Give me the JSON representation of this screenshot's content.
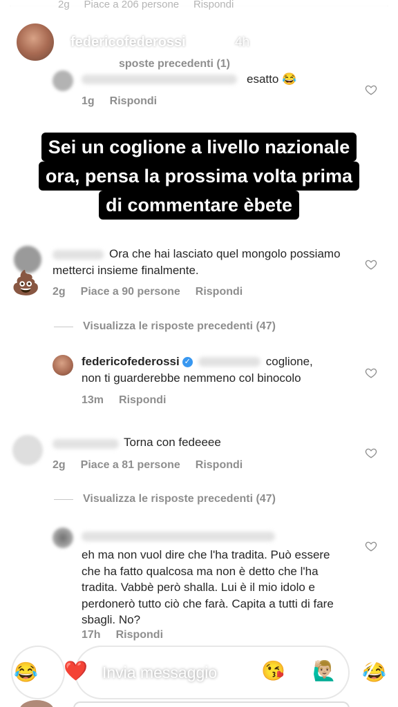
{
  "story": {
    "progress": 1.0,
    "username": "federicofederossi",
    "time": "4h",
    "underlying_text": "sposte precedenti (1)"
  },
  "top_cut_text": "2g     Piace a 206 persone     Rispondi",
  "comments": [
    {
      "text": "esatto 😂",
      "time": "1g",
      "reply": "Rispondi"
    },
    {
      "text": "Ora che hai lasciato quel mongolo possiamo metterci insieme finalmente.",
      "emoji": "💩",
      "time": "2g",
      "likes": "Piace a 90 persone",
      "reply": "Rispondi"
    },
    {
      "view_replies": "Visualizza le risposte precedenti (47)"
    },
    {
      "username": "federicofederossi",
      "text_line1": "coglione,",
      "text_line2": "non ti guarderebbe nemmeno col binocolo",
      "time": "13m",
      "reply": "Rispondi"
    },
    {
      "text": "Torna con fedeeee",
      "time": "2g",
      "likes": "Piace a 81 persone",
      "reply": "Rispondi"
    },
    {
      "view_replies": "Visualizza le risposte precedenti (47)"
    },
    {
      "text": "eh ma non vuol dire che l'ha tradita. Può essere che ha fatto qualcosa ma non è detto che l'ha tradita. Vabbè però shalla. Lui è il mio idolo e perdonerò tutto ciò che farà. Capita a tutti di fare sbagli. No?",
      "time": "17h",
      "reply": "Rispondi"
    }
  ],
  "caption": [
    "Sei un coglione a livello nazionale",
    "ora, pensa la prossima volta prima",
    "di commentare èbete"
  ],
  "footer": {
    "placeholder": "Invia messaggio",
    "emojis_left": [
      "😂",
      "❤️"
    ],
    "emojis_right": [
      "😘",
      "•••",
      "🙋🏼‍♂️",
      "😂"
    ]
  },
  "icons": {
    "close": "close-icon",
    "heart": "heart-icon",
    "camera": "camera-icon",
    "send": "send-icon",
    "verified": "verified-badge-icon"
  }
}
